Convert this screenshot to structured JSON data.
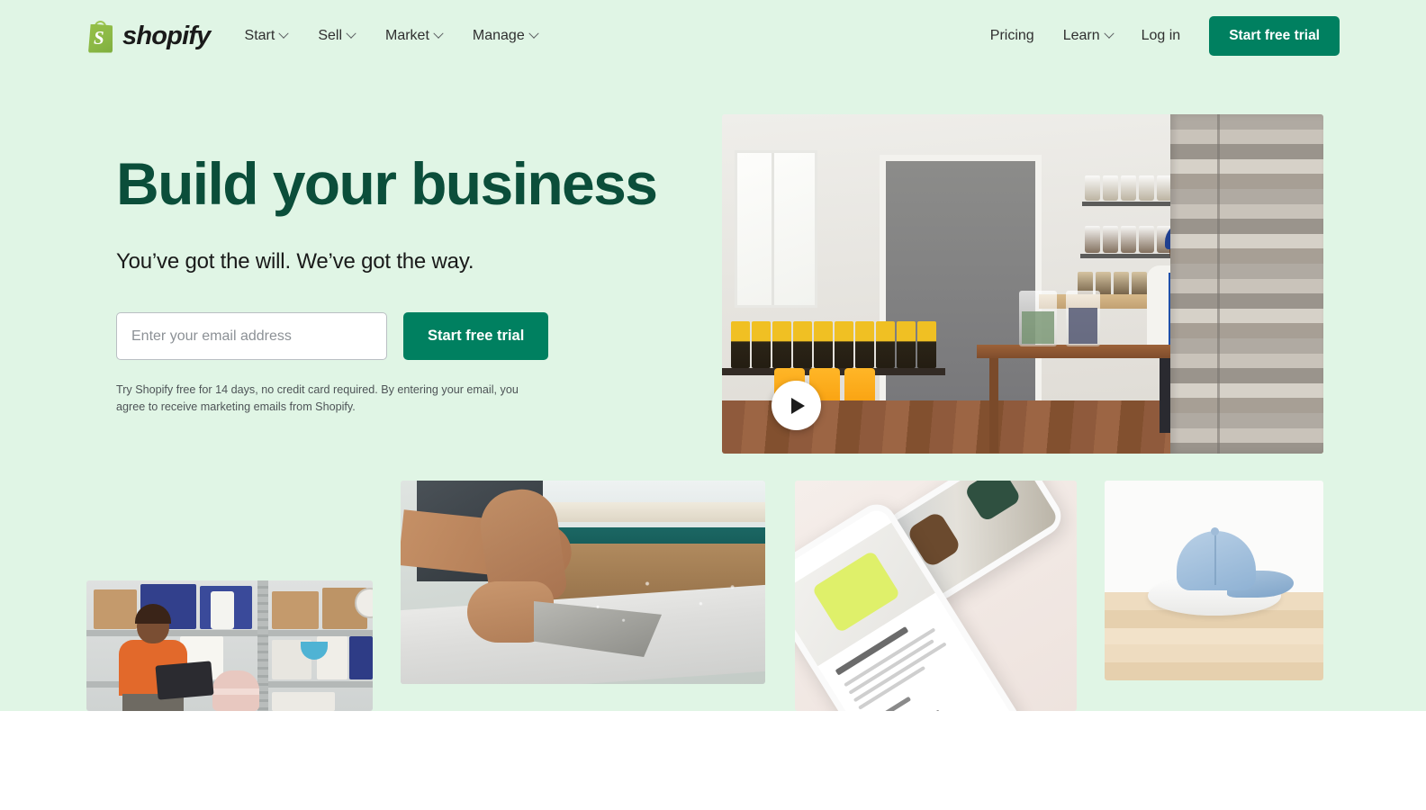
{
  "brand": {
    "name": "shopify",
    "logo_icon": "shopify-bag-icon",
    "logo_letter": "S",
    "colors": {
      "bag_green": "#95BF47",
      "primary_green": "#008060",
      "headline_green": "#0B4E3A",
      "hero_background": "#E0F5E5"
    }
  },
  "header": {
    "nav": [
      {
        "label": "Start",
        "has_dropdown": true,
        "icon": "chevron-down-icon"
      },
      {
        "label": "Sell",
        "has_dropdown": true,
        "icon": "chevron-down-icon"
      },
      {
        "label": "Market",
        "has_dropdown": true,
        "icon": "chevron-down-icon"
      },
      {
        "label": "Manage",
        "has_dropdown": true,
        "icon": "chevron-down-icon"
      }
    ],
    "nav_right": [
      {
        "label": "Pricing",
        "has_dropdown": false
      },
      {
        "label": "Learn",
        "has_dropdown": true,
        "icon": "chevron-down-icon"
      },
      {
        "label": "Log in",
        "has_dropdown": false
      }
    ],
    "cta_label": "Start free trial"
  },
  "hero": {
    "headline": "Build your business",
    "subheadline": "You’ve got the will. We’ve got the way.",
    "email_placeholder": "Enter your email address",
    "email_value": "",
    "cta_label": "Start free trial",
    "disclaimer": "Try Shopify free for 14 days, no credit card required. By entering your email, you agree to receive marketing emails from Shopify.",
    "video": {
      "name": "hero-video",
      "play_icon": "play-icon",
      "description": "Woman in blue head wrap working at a wooden table in an apothecary workshop with shelves of glass jars and a reclaimed wood wall"
    }
  },
  "gallery": [
    {
      "name": "warehouse-photo",
      "description": "Woman in orange top holding a tablet beside shelving full of boxes and packed orders"
    },
    {
      "name": "woodworking-photo",
      "description": "Close-up of hands shaping a surfboard blank with dust in the air"
    },
    {
      "name": "mobile-store-photo",
      "description": "Two phones showing a mobile storefront with the Our Core Collection product page"
    },
    {
      "name": "product-cap-photo",
      "description": "Light denim baseball cap on a white round riser on a pine surface"
    }
  ]
}
